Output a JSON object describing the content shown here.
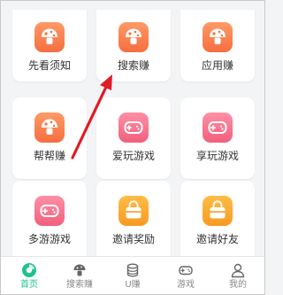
{
  "colors": {
    "accent_active": "#1ec28b",
    "arrow": "#e01b24",
    "icon_orange": "#f56e40",
    "icon_pink": "#f1607d",
    "icon_gold": "#f79a22"
  },
  "grid": {
    "items": [
      {
        "label": "先看须知",
        "icon": "mushroom-icon"
      },
      {
        "label": "搜索赚",
        "icon": "mushroom-icon"
      },
      {
        "label": "应用赚",
        "icon": "mushroom-icon"
      },
      {
        "label": "帮帮赚",
        "icon": "mushroom-icon"
      },
      {
        "label": "爱玩游戏",
        "icon": "gamepad-icon"
      },
      {
        "label": "享玩游戏",
        "icon": "gamepad-icon"
      },
      {
        "label": "多游游戏",
        "icon": "gamepad-icon"
      },
      {
        "label": "邀请奖励",
        "icon": "shopping-bag-icon"
      },
      {
        "label": "邀请好友",
        "icon": "shopping-bag-icon"
      }
    ]
  },
  "bottom_nav": {
    "tabs": [
      {
        "label": "首页",
        "icon": "home-icon",
        "active": true
      },
      {
        "label": "搜索赚",
        "icon": "mushroom-icon",
        "active": false
      },
      {
        "label": "U赚",
        "icon": "coins-icon",
        "active": false
      },
      {
        "label": "游戏",
        "icon": "gamepad-icon",
        "active": false
      },
      {
        "label": "我的",
        "icon": "user-icon",
        "active": false
      }
    ]
  }
}
